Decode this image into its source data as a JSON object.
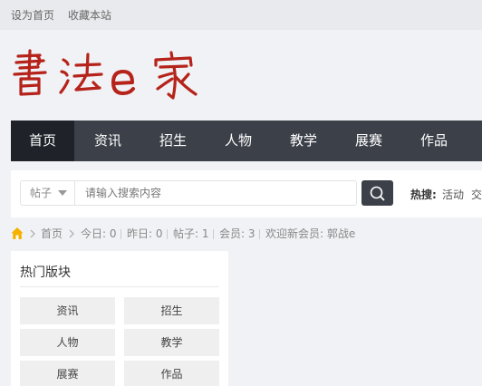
{
  "topbar": {
    "set_home": "设为首页",
    "bookmark": "收藏本站"
  },
  "logo": {
    "text": "書法e家",
    "color": "#b5231b"
  },
  "nav": {
    "items": [
      "首页",
      "资讯",
      "招生",
      "人物",
      "教学",
      "展赛",
      "作品"
    ],
    "active_index": 0
  },
  "search": {
    "type_label": "帖子",
    "placeholder": "请输入搜索内容",
    "value": ""
  },
  "hot": {
    "label": "热搜:",
    "items": [
      "活动",
      "交"
    ]
  },
  "stats": {
    "crumb_home": "首页",
    "today": "今日: 0",
    "yesterday": "昨日: 0",
    "posts": "帖子: 1",
    "members": "会员: 3",
    "welcome": "欢迎新会员: 郭战e"
  },
  "panel": {
    "title": "热门版块",
    "boards": [
      "资讯",
      "招生",
      "人物",
      "教学",
      "展赛",
      "作品"
    ]
  },
  "colors": {
    "nav_bg": "#3c4149",
    "nav_active": "#1f2329",
    "home_icon": "#f6b100"
  }
}
